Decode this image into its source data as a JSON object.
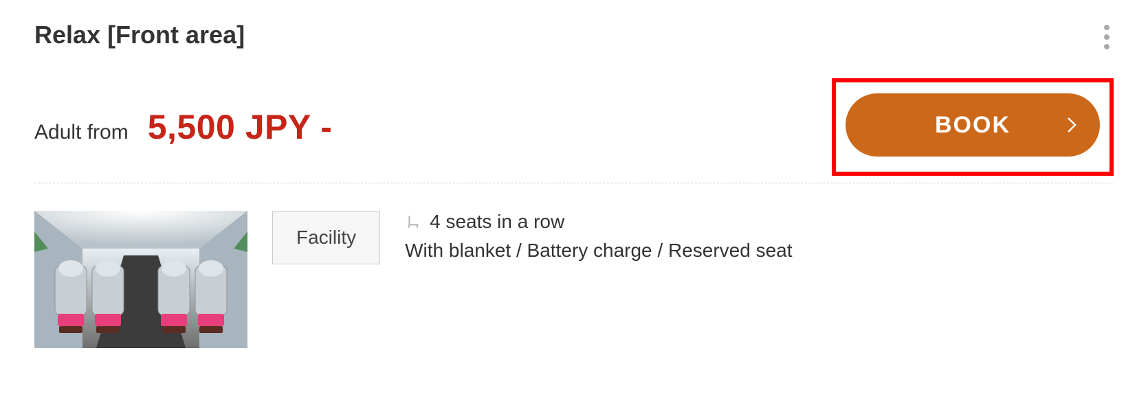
{
  "title": "Relax [Front area]",
  "price": {
    "label": "Adult from",
    "value": "5,500 JPY -"
  },
  "book_button": "BOOK",
  "facility": {
    "badge": "Facility",
    "seats": "4 seats in a row",
    "features": "With blanket / Battery charge / Reserved seat"
  }
}
